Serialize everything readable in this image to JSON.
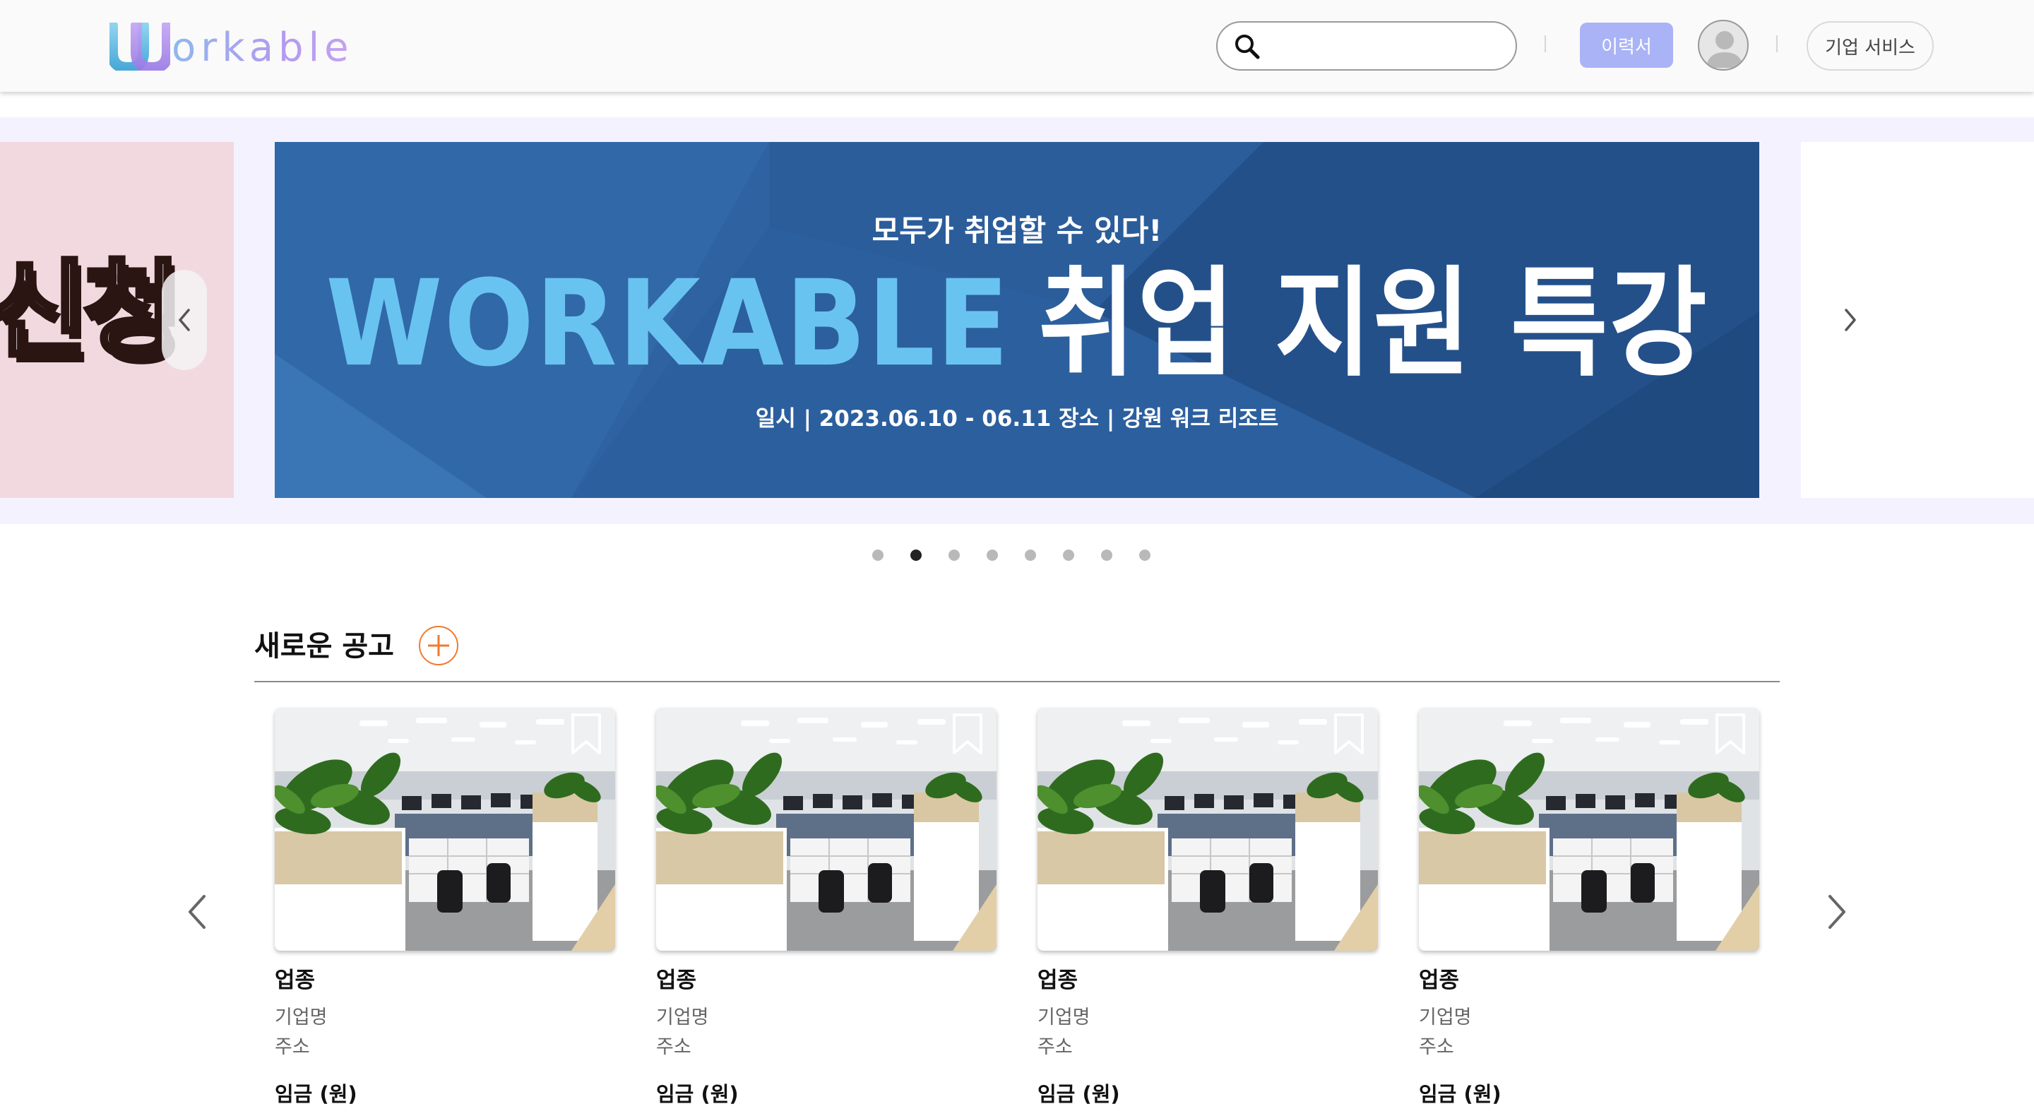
{
  "header": {
    "logo_text": "orkable",
    "search": {
      "value": "",
      "placeholder": ""
    },
    "resume_label": "이력서",
    "corporate_label": "기업 서비스"
  },
  "banner": {
    "prev_slide_text": "신청",
    "main_slide": {
      "kicker": "모두가 취업할 수 있다!",
      "headline_brand": "WORKABLE",
      "headline_rest": "취업 지원 특강",
      "subtitle": "일시 | 2023.06.10 - 06.11 장소 | 강원 워크 리조트"
    },
    "dots_count": 8,
    "active_dot": 1
  },
  "section": {
    "title": "새로운 공고"
  },
  "cards": [
    {
      "industry": "업종",
      "company": "기업명",
      "address": "주소",
      "wage": "임금 (원)"
    },
    {
      "industry": "업종",
      "company": "기업명",
      "address": "주소",
      "wage": "임금 (원)"
    },
    {
      "industry": "업종",
      "company": "기업명",
      "address": "주소",
      "wage": "임금 (원)"
    },
    {
      "industry": "업종",
      "company": "기업명",
      "address": "주소",
      "wage": "임금 (원)"
    }
  ],
  "icons": {
    "logo": "workable-w-logo",
    "search": "search-icon",
    "avatar": "user-avatar-icon",
    "prev": "chevron-left-icon",
    "next": "chevron-right-icon",
    "more": "plus-circle-icon",
    "bookmark": "bookmark-icon"
  },
  "colors": {
    "accent": "#a9b3f5",
    "banner_bg": "#2e62a1",
    "headline_brand": "#69c3f0",
    "plus_orange": "#f07a2e",
    "strip_bg": "#f4f2fe",
    "prev_slide_bg": "#f2d9df"
  }
}
